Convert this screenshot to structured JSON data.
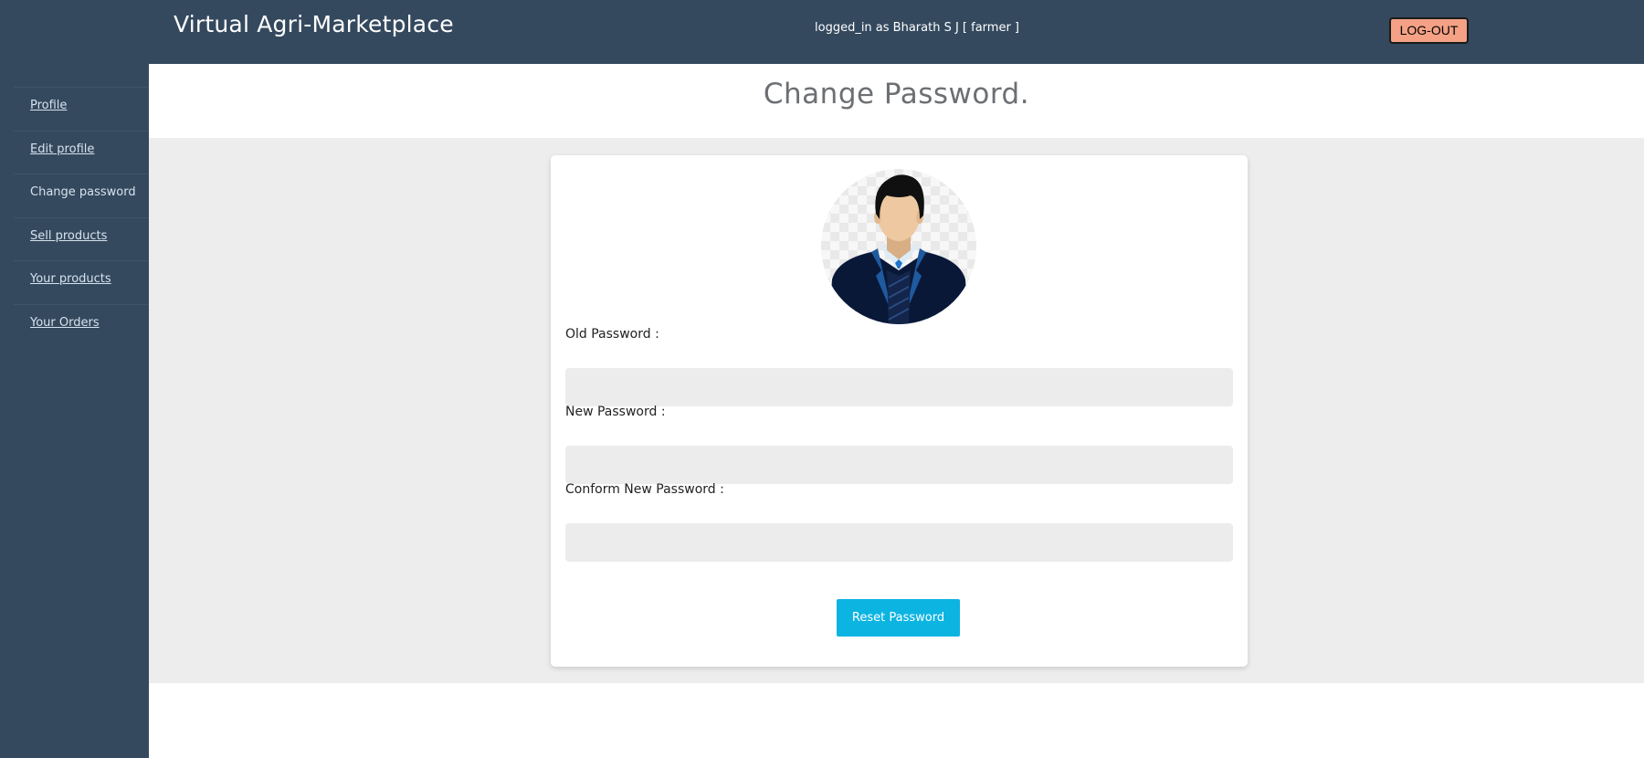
{
  "header": {
    "brand": "Virtual Agri-Marketplace",
    "logged_in_text": "logged_in as Bharath S J [ farmer ]",
    "logout_label": "LOG-OUT"
  },
  "sidebar": {
    "items": [
      {
        "label": "Profile"
      },
      {
        "label": "Edit profile"
      },
      {
        "label": "Change password"
      },
      {
        "label": "Sell products"
      },
      {
        "label": "Your products"
      },
      {
        "label": "Your Orders"
      }
    ]
  },
  "main": {
    "title": "Change Password.",
    "form": {
      "old_password_label": "Old Password :",
      "old_password_value": "",
      "new_password_label": "New Password :",
      "new_password_value": "",
      "confirm_password_label": "Conform New Password :",
      "confirm_password_value": "",
      "submit_label": "Reset Password"
    }
  },
  "colors": {
    "nav_bg": "#34495e",
    "content_bg": "#ededed",
    "logout_bg": "#f4a185",
    "accent": "#0cb4e2",
    "title_text": "#6c6f73"
  },
  "icons": {
    "avatar": "user-avatar-icon"
  }
}
